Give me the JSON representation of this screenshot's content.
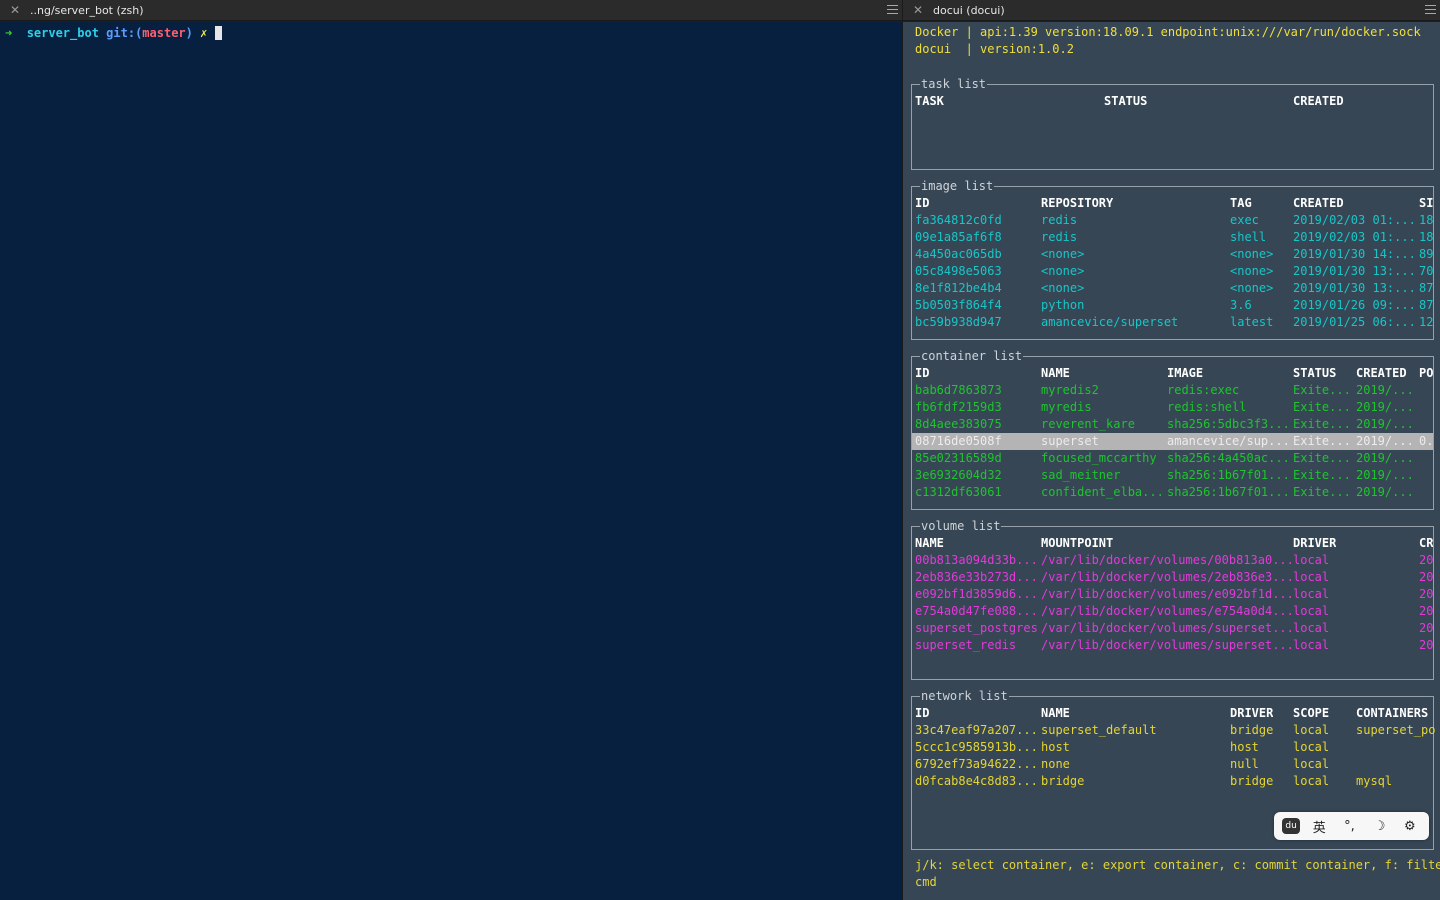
{
  "left_tab": {
    "title": "..ng/server_bot (zsh)"
  },
  "right_tab": {
    "title": "docui (docui)"
  },
  "terminal": {
    "arrow": "➜",
    "dir": "server_bot",
    "git_label": "git:(",
    "branch": "master",
    "git_close": ")",
    "dirty": "✗"
  },
  "header_lines": [
    "Docker | api:1.39 version:18.09.1 endpoint:unix:///var/run/docker.sock",
    "docui  | version:1.0.2"
  ],
  "task_list": {
    "title": "task list",
    "columns": [
      "TASK",
      "STATUS",
      "CREATED"
    ]
  },
  "image_list": {
    "title": "image list",
    "columns": [
      "ID",
      "REPOSITORY",
      "TAG",
      "CREATED",
      "SI"
    ],
    "rows": [
      [
        "fa364812c0fd",
        "redis",
        "exec",
        "2019/02/03 01:...",
        "18"
      ],
      [
        "09e1a85af6f8",
        "redis",
        "shell",
        "2019/02/03 01:...",
        "18"
      ],
      [
        "4a450ac065db",
        "<none>",
        "<none>",
        "2019/01/30 14:...",
        "89"
      ],
      [
        "05c8498e5063",
        "<none>",
        "<none>",
        "2019/01/30 13:...",
        "70"
      ],
      [
        "8e1f812be4b4",
        "<none>",
        "<none>",
        "2019/01/30 13:...",
        "87"
      ],
      [
        "5b0503f864f4",
        "python",
        "3.6",
        "2019/01/26 09:...",
        "87"
      ],
      [
        "bc59b938d947",
        "amancevice/superset",
        "latest",
        "2019/01/25 06:...",
        "12"
      ]
    ]
  },
  "container_list": {
    "title": "container list",
    "columns": [
      "ID",
      "NAME",
      "IMAGE",
      "STATUS",
      "CREATED",
      "PO"
    ],
    "selected_index": 3,
    "rows": [
      [
        "bab6d7863873",
        "myredis2",
        "redis:exec",
        "Exite...",
        "2019/...",
        ""
      ],
      [
        "fb6fdf2159d3",
        "myredis",
        "redis:shell",
        "Exite...",
        "2019/...",
        ""
      ],
      [
        "8d4aee383075",
        "reverent_kare",
        "sha256:5dbc3f3...",
        "Exite...",
        "2019/...",
        ""
      ],
      [
        "08716de0508f",
        "superset",
        "amancevice/sup...",
        "Exite...",
        "2019/...",
        "0."
      ],
      [
        "85e02316589d",
        "focused_mccarthy",
        "sha256:4a450ac...",
        "Exite...",
        "2019/...",
        ""
      ],
      [
        "3e6932604d32",
        "sad_meitner",
        "sha256:1b67f01...",
        "Exite...",
        "2019/...",
        ""
      ],
      [
        "c1312df63061",
        "confident_elba...",
        "sha256:1b67f01...",
        "Exite...",
        "2019/...",
        ""
      ]
    ]
  },
  "volume_list": {
    "title": "volume list",
    "columns": [
      "NAME",
      "MOUNTPOINT",
      "DRIVER",
      "CR"
    ],
    "rows": [
      [
        "00b813a094d33b...",
        "/var/lib/docker/volumes/00b813a0...",
        "local",
        "20"
      ],
      [
        "2eb836e33b273d...",
        "/var/lib/docker/volumes/2eb836e3...",
        "local",
        "20"
      ],
      [
        "e092bf1d3859d6...",
        "/var/lib/docker/volumes/e092bf1d...",
        "local",
        "20"
      ],
      [
        "e754a0d47fe088...",
        "/var/lib/docker/volumes/e754a0d4...",
        "local",
        "20"
      ],
      [
        "superset_postgres",
        "/var/lib/docker/volumes/superset...",
        "local",
        "20"
      ],
      [
        "superset_redis",
        "/var/lib/docker/volumes/superset...",
        "local",
        "20"
      ]
    ]
  },
  "network_list": {
    "title": "network list",
    "columns": [
      "ID",
      "NAME",
      "DRIVER",
      "SCOPE",
      "CONTAINERS"
    ],
    "rows": [
      [
        "33c47eaf97a207...",
        "superset_default",
        "bridge",
        "local",
        "superset_po"
      ],
      [
        "5ccc1c9585913b...",
        "host",
        "host",
        "local",
        ""
      ],
      [
        "6792ef73a94622...",
        "none",
        "null",
        "local",
        ""
      ],
      [
        "d0fcab8e4c8d83...",
        "bridge",
        "bridge",
        "local",
        "mysql"
      ]
    ]
  },
  "help": {
    "line1": "j/k: select container, e: export container, c: commit container, f: filter",
    "line2": "cmd"
  },
  "ime": {
    "logo": "du",
    "lang": "英",
    "punct": "°,",
    "moon_icon": "☽",
    "gear_icon": "⚙"
  },
  "colors": {
    "terminal_bg": "#07203f",
    "docui_bg": "#364655",
    "image_rows": "#18c6c7",
    "container_rows": "#1fc42e",
    "volume_rows": "#e33ad9",
    "network_rows": "#e6d531",
    "header_text": "#f1df3c"
  }
}
